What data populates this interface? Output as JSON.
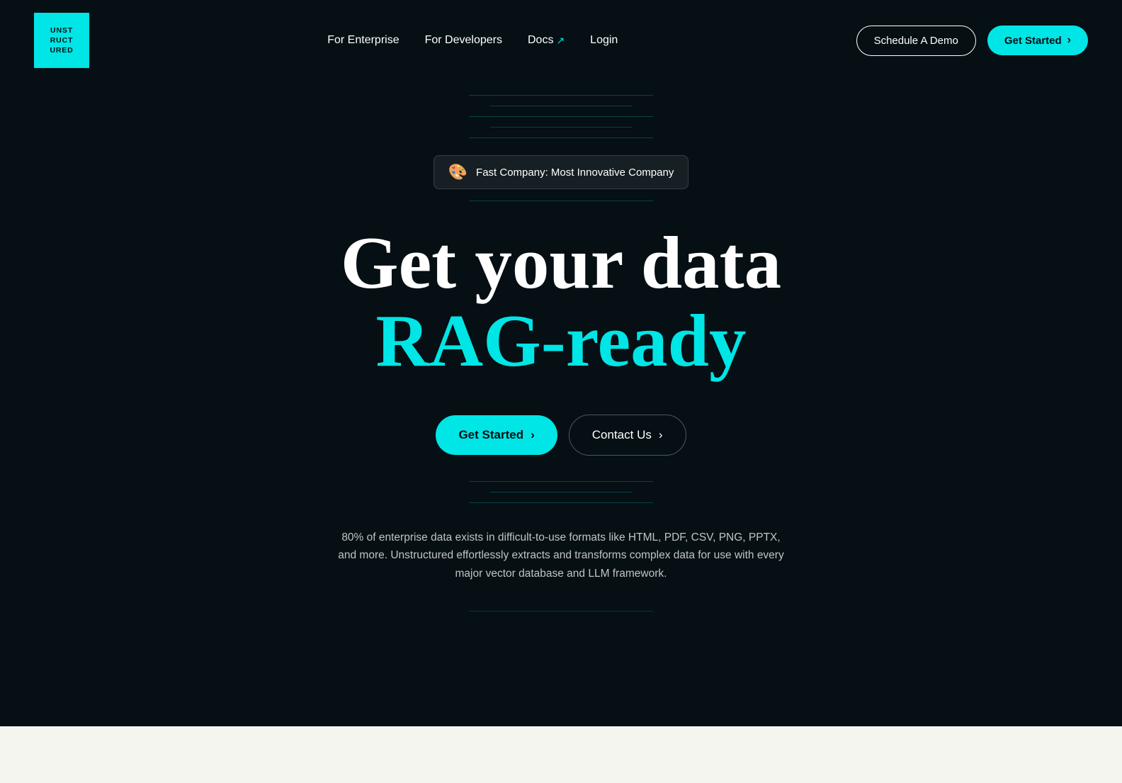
{
  "nav": {
    "logo_lines": [
      "UNST",
      "RUCT",
      "URED"
    ],
    "links": [
      {
        "label": "For Enterprise",
        "has_arrow": false
      },
      {
        "label": "For Developers",
        "has_arrow": false
      },
      {
        "label": "Docs",
        "has_arrow": true
      },
      {
        "label": "Login",
        "has_arrow": false
      }
    ],
    "schedule_demo_label": "Schedule A Demo",
    "get_started_label": "Get Started",
    "get_started_chevron": "›"
  },
  "hero": {
    "badge_icon": "🎨",
    "badge_text": "Fast Company: Most Innovative Company",
    "title_line1": "Get your data",
    "title_line2": "RAG-ready",
    "cta_primary_label": "Get Started",
    "cta_primary_chevron": "›",
    "cta_secondary_label": "Contact Us",
    "cta_secondary_chevron": "›",
    "description": "80% of enterprise data exists in difficult-to-use formats like HTML, PDF, CSV, PNG, PPTX, and more. Unstructured effortlessly extracts and transforms complex data for use with every major vector database and LLM framework."
  }
}
